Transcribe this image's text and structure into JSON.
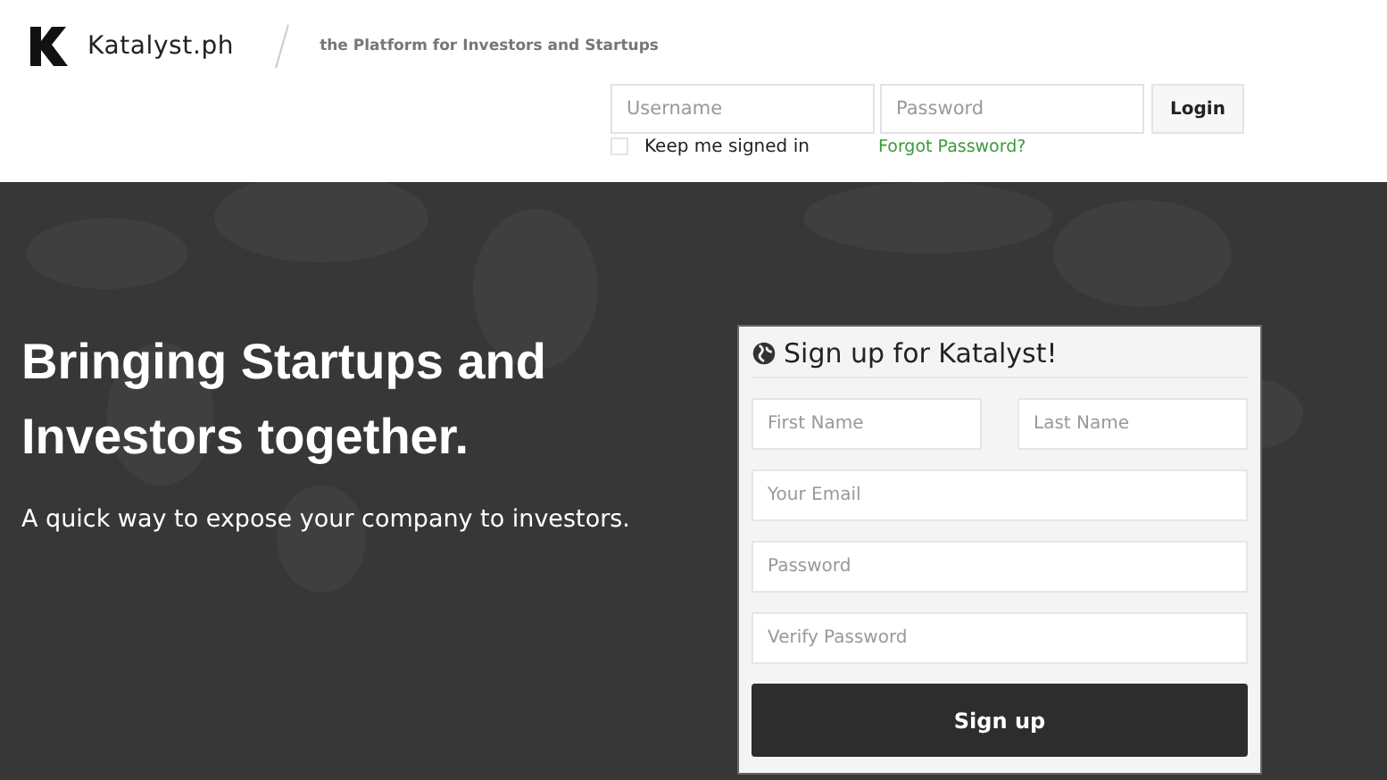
{
  "header": {
    "logo_text": "Katalyst.ph",
    "tagline": "the Platform for Investors and Startups"
  },
  "login": {
    "username": {
      "placeholder": "Username"
    },
    "password": {
      "placeholder": "Password"
    },
    "button": "Login",
    "keep_signed_in": {
      "label": "Keep me signed in",
      "checked": false
    },
    "forgot_link": "Forgot Password?"
  },
  "hero": {
    "headline": "Bringing Startups and Investors together.",
    "subtitle": "A quick way to expose your company to investors."
  },
  "signup": {
    "title": "Sign up for Katalyst!",
    "name_fields": [
      {
        "placeholder": "First Name"
      },
      {
        "placeholder": "Last Name"
      }
    ],
    "fields": [
      {
        "placeholder": "Your Email"
      },
      {
        "placeholder": "Password"
      },
      {
        "placeholder": "Verify Password"
      }
    ],
    "button": "Sign up"
  }
}
